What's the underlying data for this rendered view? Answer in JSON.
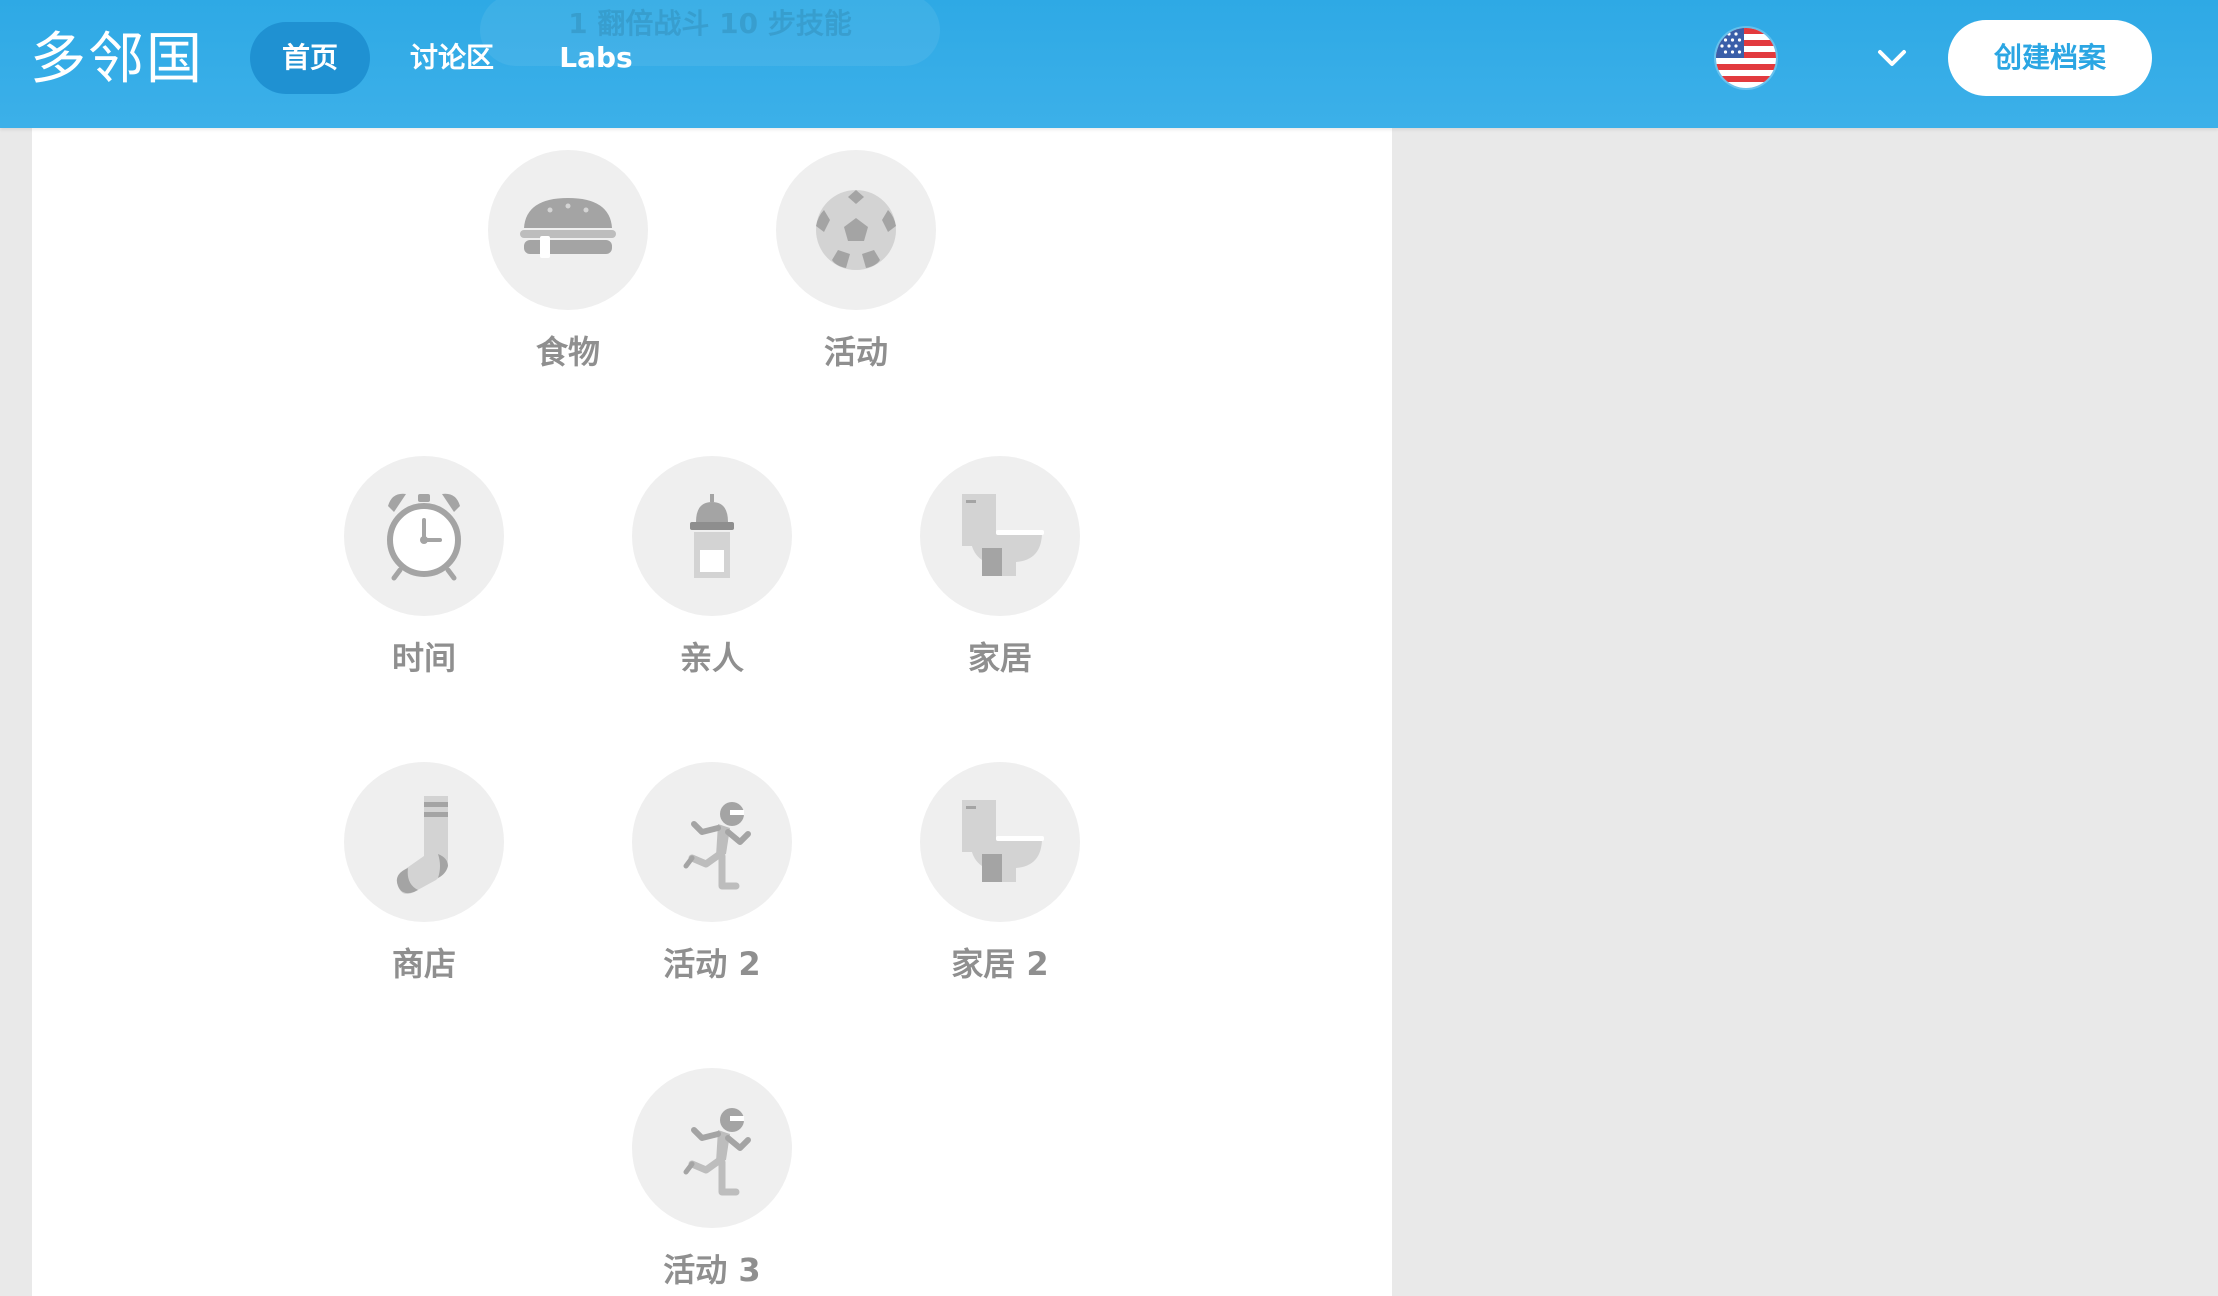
{
  "header": {
    "logo": "多邻国",
    "nav": {
      "home": "首页",
      "forum": "讨论区",
      "labs": "Labs"
    },
    "ghost_text": "1 翻倍战斗 10 步技能",
    "language_flag": "us-flag-icon",
    "create_profile": "创建档案"
  },
  "skills": [
    {
      "label": "食物",
      "icon": "hamburger-icon"
    },
    {
      "label": "活动",
      "icon": "soccer-ball-icon"
    },
    {
      "label": "时间",
      "icon": "alarm-clock-icon"
    },
    {
      "label": "亲人",
      "icon": "baby-bottle-icon"
    },
    {
      "label": "家居",
      "icon": "toilet-icon"
    },
    {
      "label": "商店",
      "icon": "sock-icon"
    },
    {
      "label": "活动 2",
      "icon": "runner-icon"
    },
    {
      "label": "家居 2",
      "icon": "toilet-icon"
    },
    {
      "label": "活动 3",
      "icon": "runner-icon"
    }
  ],
  "colors": {
    "header_blue": "#2ea9e5",
    "active_nav": "#1f91d2",
    "skill_circle": "#efefef",
    "skill_icon": "#a4a4a4",
    "label_gray": "#8f8f8f"
  }
}
